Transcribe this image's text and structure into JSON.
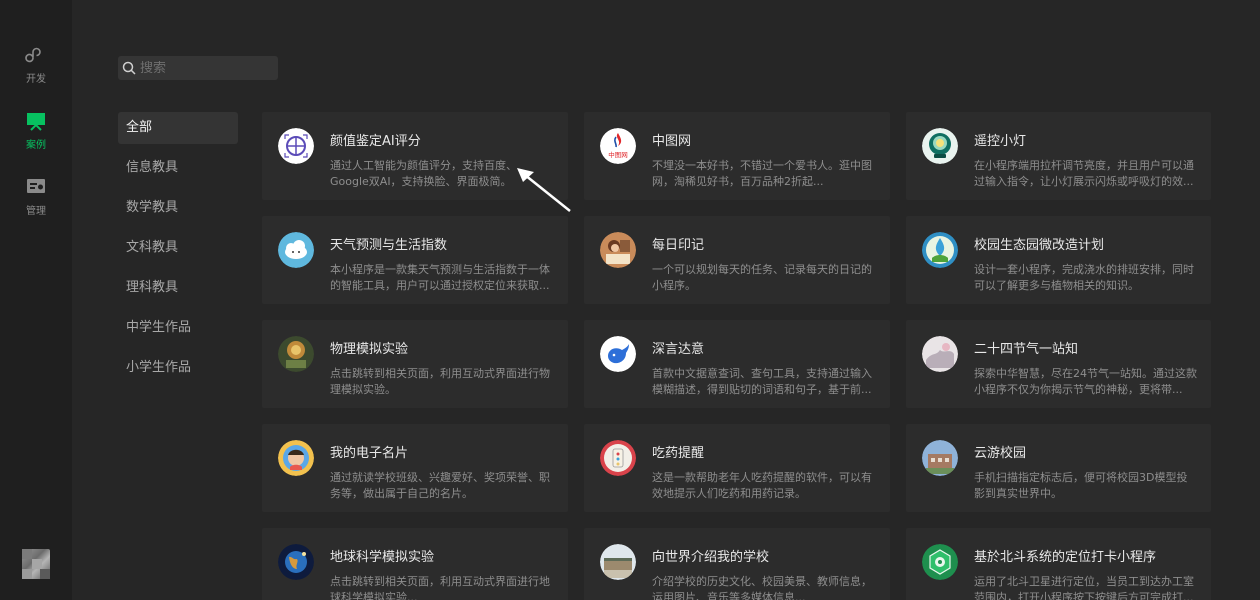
{
  "rail": {
    "items": [
      {
        "label": "开发",
        "icon": "miniprogram-icon"
      },
      {
        "label": "案例",
        "icon": "cases-icon",
        "active": true
      },
      {
        "label": "管理",
        "icon": "manage-icon"
      }
    ],
    "accent": "#07c160"
  },
  "search": {
    "placeholder": "搜索",
    "value": ""
  },
  "categories": [
    "全部",
    "信息教具",
    "数学教具",
    "文科教具",
    "理科教具",
    "中学生作品",
    "小学生作品"
  ],
  "cards": [
    {
      "title": "颜值鉴定AI评分",
      "desc": "通过人工智能为颜值评分，支持百度、Google双AI，支持换脸、界面极简。"
    },
    {
      "title": "中图网",
      "desc": "不埋没一本好书，不错过一个爱书人。逛中图网，淘稀见好书，百万品种2折起..."
    },
    {
      "title": "遥控小灯",
      "desc": "在小程序端用拉杆调节亮度，并且用户可以通过输入指令，让小灯展示闪烁或呼吸灯的效..."
    },
    {
      "title": "天气预测与生活指数",
      "desc": "本小程序是一款集天气预测与生活指数于一体的智能工具，用户可以通过授权定位来获取..."
    },
    {
      "title": "每日印记",
      "desc": "一个可以规划每天的任务、记录每天的日记的小程序。"
    },
    {
      "title": "校园生态园微改造计划",
      "desc": "设计一套小程序，完成浇水的排班安排，同时可以了解更多与植物相关的知识。"
    },
    {
      "title": "物理模拟实验",
      "desc": "点击跳转到相关页面，利用互动式界面进行物理模拟实验。"
    },
    {
      "title": "深言达意",
      "desc": "首款中文据意查词、查句工具，支持通过输入模糊描述，得到贴切的词语和句子，基于前..."
    },
    {
      "title": "二十四节气一站知",
      "desc": "探索中华智慧，尽在24节气一站知。通过这款小程序不仅为你揭示节气的神秘，更将带..."
    },
    {
      "title": "我的电子名片",
      "desc": "通过就读学校班级、兴趣爱好、奖项荣誉、职务等，做出属于自己的名片。"
    },
    {
      "title": "吃药提醒",
      "desc": "这是一款帮助老年人吃药提醒的软件，可以有效地提示人们吃药和用药记录。"
    },
    {
      "title": "云游校园",
      "desc": "手机扫描指定标志后，便可将校园3D模型投影到真实世界中。"
    },
    {
      "title": "地球科学模拟实验",
      "desc": "点击跳转到相关页面，利用互动式界面进行地球科学模拟实验..."
    },
    {
      "title": "向世界介绍我的学校",
      "desc": "介绍学校的历史文化、校园美景、教师信息，运用图片、音乐等多媒体信息..."
    },
    {
      "title": "基於北斗系统的定位打卡小程序",
      "desc": "运用了北斗卫星进行定位，当员工到达办工室范围内，打开小程序按下按键后方可完成打..."
    }
  ],
  "icon_badges": {
    "zhongtu": "中图网"
  }
}
